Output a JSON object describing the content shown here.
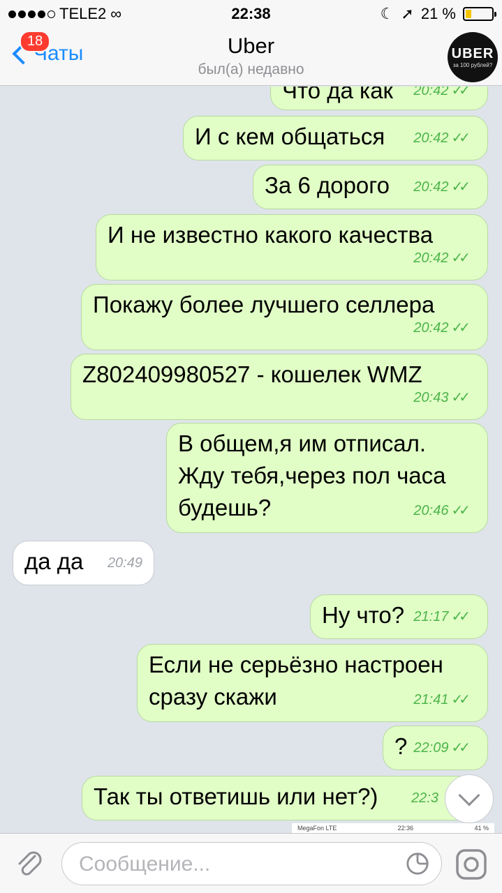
{
  "status": {
    "carrier": "TELE2",
    "time": "22:38",
    "battery": "21 %",
    "battery_level": 0.21
  },
  "nav": {
    "back_label": "Чаты",
    "badge": "18",
    "title": "Uber",
    "subtitle": "был(а) недавно",
    "avatar_text": "UBER",
    "avatar_sub": "за 100 рублей?"
  },
  "messages": [
    {
      "text": "Что да как",
      "time": "20:42",
      "dir": "out"
    },
    {
      "text": "И с кем общаться",
      "time": "20:42",
      "dir": "out"
    },
    {
      "text": "За 6 дорого",
      "time": "20:42",
      "dir": "out"
    },
    {
      "text": "И не известно какого качества",
      "time": "20:42",
      "dir": "out"
    },
    {
      "text": "Покажу более лучшего селлера",
      "time": "20:42",
      "dir": "out"
    },
    {
      "text": "Z802409980527 - кошелек WMZ",
      "time": "20:43",
      "dir": "out"
    },
    {
      "text": "В общем,я им отписал.\nЖду тебя,через пол часа\nбудешь?",
      "time": "20:46",
      "dir": "out"
    },
    {
      "text": "да да",
      "time": "20:49",
      "dir": "in"
    },
    {
      "text": "Ну что?",
      "time": "21:17",
      "dir": "out"
    },
    {
      "text": "Если не серьёзно настроен\nсразу скажи",
      "time": "21:41",
      "dir": "out"
    },
    {
      "text": "?",
      "time": "22:09",
      "dir": "out"
    },
    {
      "text": "Так ты ответишь или нет?)",
      "time": "22:3",
      "dir": "out"
    }
  ],
  "preview_strip": {
    "left": "MegaFon LTE",
    "center": "22:36",
    "right": "41 %"
  },
  "input": {
    "placeholder": "Сообщение..."
  },
  "colors": {
    "outgoing": "#e1fec6",
    "incoming": "#ffffff",
    "accent": "#1a8cff",
    "tick": "#4cb44a"
  }
}
